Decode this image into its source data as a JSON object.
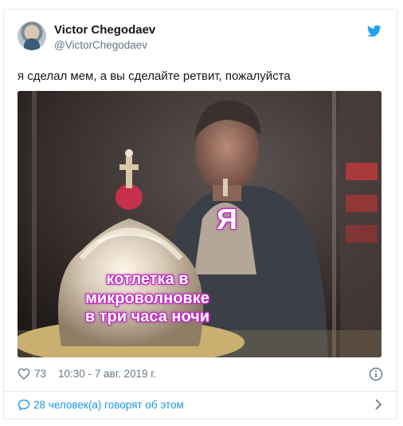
{
  "tweet": {
    "author_name": "Victor Chegodaev",
    "author_handle": "@VictorChegodaev",
    "text": "я сделал мем, а вы сделайте ретвит, пожалуйста",
    "meme": {
      "caption_top": "Я",
      "caption_bottom_lines": [
        "котлетка в",
        "микроволновке",
        "в три часа ночи"
      ]
    },
    "likes": "73",
    "timestamp": "10:30 - 7 авг. 2019 г.",
    "conversation": "28 человек(а) говорят об этом"
  },
  "icons": {
    "bird": "twitter-bird-icon",
    "heart": "heart-icon",
    "info": "info-icon",
    "bubble": "speech-bubble-icon",
    "chevron": "chevron-right-icon"
  },
  "colors": {
    "accent": "#1da1f2",
    "link": "#1b95e0",
    "muted": "#657786",
    "border": "#e1e8ed",
    "caption_glow": "#c629c6"
  }
}
